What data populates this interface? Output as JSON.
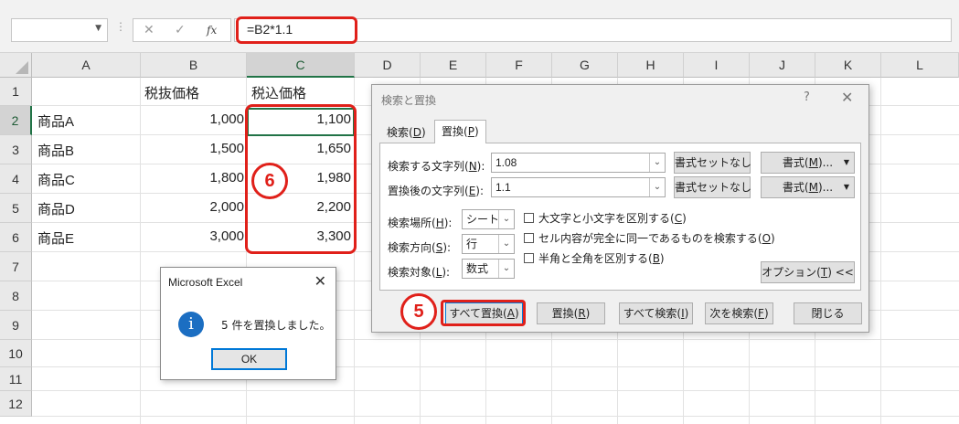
{
  "formula_bar": {
    "name_box": "",
    "cancel_icon": "✕",
    "enter_icon": "✓",
    "fx_label": "fx",
    "formula": "=B2*1.1"
  },
  "columns": [
    "A",
    "B",
    "C",
    "D",
    "E",
    "F",
    "G",
    "H",
    "I",
    "J",
    "K",
    "L"
  ],
  "rows": [
    "1",
    "2",
    "3",
    "4",
    "5",
    "6",
    "7",
    "8",
    "9",
    "10",
    "11",
    "12"
  ],
  "headers": {
    "b1": "税抜価格",
    "c1": "税込価格"
  },
  "table": [
    {
      "name": "商品A",
      "pretax": "1,000",
      "taxed": "1,100"
    },
    {
      "name": "商品B",
      "pretax": "1,500",
      "taxed": "1,650"
    },
    {
      "name": "商品C",
      "pretax": "1,800",
      "taxed": "1,980"
    },
    {
      "name": "商品D",
      "pretax": "2,000",
      "taxed": "2,200"
    },
    {
      "name": "商品E",
      "pretax": "3,000",
      "taxed": "3,300"
    }
  ],
  "badges": {
    "step6": "6",
    "step5": "5"
  },
  "message_box": {
    "title": "Microsoft Excel",
    "close": "✕",
    "icon": "i",
    "text": "5 件を置換しました。",
    "ok": "OK"
  },
  "dialog": {
    "title": "検索と置換",
    "help": "?",
    "close": "✕",
    "tab_find": {
      "pre": "検索(",
      "key": "D",
      "post": ")"
    },
    "tab_replace": {
      "pre": "置換(",
      "key": "P",
      "post": ")"
    },
    "search_label": {
      "pre": "検索する文字列(",
      "key": "N",
      "post": "):"
    },
    "search_value": "1.08",
    "replace_label": {
      "pre": "置換後の文字列(",
      "key": "E",
      "post": "):"
    },
    "replace_value": "1.1",
    "no_format": "書式セットなし",
    "format_btn": {
      "pre": "書式(",
      "key": "M",
      "post": ")..."
    },
    "within_label": {
      "pre": "検索場所(",
      "key": "H",
      "post": "):"
    },
    "within_value": "シート",
    "direction_label": {
      "pre": "検索方向(",
      "key": "S",
      "post": "):"
    },
    "direction_value": "行",
    "lookin_label": {
      "pre": "検索対象(",
      "key": "L",
      "post": "):"
    },
    "lookin_value": "数式",
    "opt_case": {
      "pre": "大文字と小文字を区別する(",
      "key": "C",
      "post": ")"
    },
    "opt_whole": {
      "pre": "セル内容が完全に同一であるものを検索する(",
      "key": "O",
      "post": ")"
    },
    "opt_width": {
      "pre": "半角と全角を区別する(",
      "key": "B",
      "post": ")"
    },
    "options_btn": {
      "pre": "オプション(",
      "key": "T",
      "post": ") <<"
    },
    "replace_all": {
      "pre": "すべて置換(",
      "key": "A",
      "post": ")"
    },
    "replace": {
      "pre": "置換(",
      "key": "R",
      "post": ")"
    },
    "find_all": {
      "pre": "すべて検索(",
      "key": "I",
      "post": ")"
    },
    "find_next": {
      "pre": "次を検索(",
      "key": "F",
      "post": ")"
    },
    "close_btn": "閉じる"
  }
}
